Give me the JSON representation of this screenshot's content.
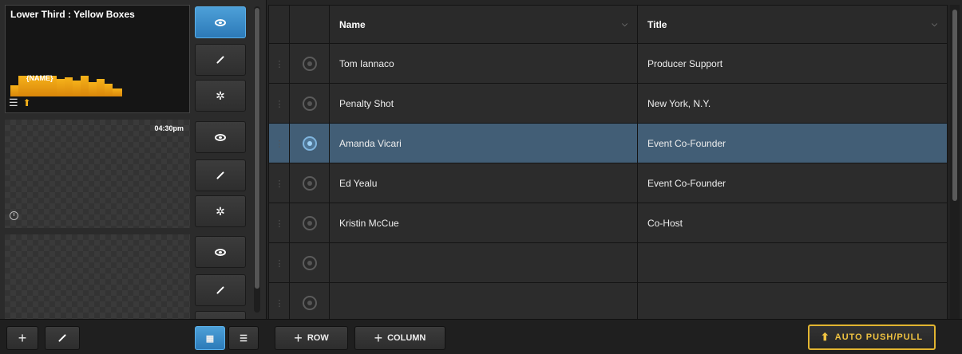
{
  "left_panel": {
    "slots": [
      {
        "title": "Lower Third : Yellow Boxes",
        "graphic_label": "{NAME}",
        "time": "",
        "active": true
      },
      {
        "title": "",
        "graphic_label": "",
        "time": "04:30pm",
        "active": false
      },
      {
        "title": "",
        "graphic_label": "",
        "time": "",
        "active": false
      }
    ]
  },
  "table": {
    "columns": [
      {
        "label": "Name"
      },
      {
        "label": "Title"
      }
    ],
    "rows": [
      {
        "name": "Tom Iannaco",
        "title": "Producer Support",
        "selected": false
      },
      {
        "name": "Penalty Shot",
        "title": "New York, N.Y.",
        "selected": false
      },
      {
        "name": "Amanda Vicari",
        "title": "Event Co-Founder",
        "selected": true
      },
      {
        "name": "Ed Yealu",
        "title": "Event Co-Founder",
        "selected": false
      },
      {
        "name": "Kristin McCue",
        "title": "Co-Host",
        "selected": false
      },
      {
        "name": "",
        "title": "",
        "selected": false
      },
      {
        "name": "",
        "title": "",
        "selected": false
      }
    ]
  },
  "bottom_bar": {
    "add_row_label": "ROW",
    "add_column_label": "COLUMN",
    "auto_push_pull_label": "AUTO PUSH/PULL"
  },
  "colors": {
    "accent_blue": "#2c7ab8",
    "selected_row": "#425e76",
    "auto_push_border": "#e2b531",
    "lower_third_yellow": "#f6b21a"
  },
  "icons": [
    "eye-icon",
    "brush-icon",
    "gear-icon",
    "plus-icon",
    "list-icon",
    "upload-arrow-icon",
    "clock-icon",
    "grip-icon",
    "radio-icon",
    "chevron-down-icon",
    "grid-view-icon"
  ]
}
